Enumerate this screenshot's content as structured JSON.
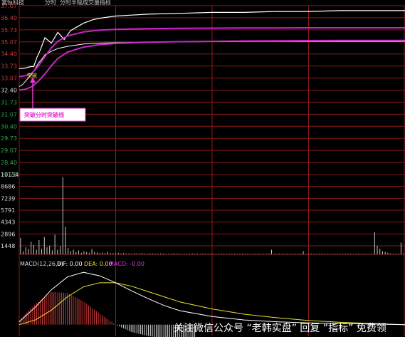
{
  "header": {
    "items": [
      "富恒科技",
      "分时",
      "分时半幅",
      "成交量",
      "指标"
    ]
  },
  "callout": {
    "label": "突破分时突破线",
    "marker": "突破"
  },
  "watermark": {
    "text": "关注微信公众号 “老韩实盘” 回复 “指标” 免费领"
  },
  "colors": {
    "background": "#000000",
    "grid": "#8b1a1a",
    "price_line": "#ffffff",
    "avg_line": "#ffffff",
    "channel_upper": "#c727c7",
    "channel_lower": "#c727c7",
    "volume": "#c8c8c8",
    "macd_hist_up": "#d23a3a",
    "macd_hist_down": "#e0e0e0",
    "dif_line": "#ffffff",
    "dea_line": "#e8e030",
    "callout": "#e23bd0"
  },
  "chart_data": [
    {
      "type": "line",
      "panel": "price",
      "y_ticks_upper": [
        "37.07",
        "36.40",
        "35.73",
        "35.07",
        "34.40",
        "33.73",
        "33.07"
      ],
      "y_tick_mid": "32.40",
      "y_ticks_lower": [
        "31.73",
        "31.07",
        "30.40",
        "29.73",
        "29.07",
        "28.40",
        "27.73"
      ],
      "ylim": [
        27.73,
        37.07
      ],
      "series": [
        {
          "role": "price",
          "x": [
            0,
            2,
            5,
            7,
            9,
            11,
            13,
            16,
            20,
            24,
            28,
            32,
            36,
            40,
            46,
            52,
            60,
            70,
            80,
            100,
            120,
            140,
            160,
            180,
            200,
            220,
            240
          ],
          "values": [
            33.6,
            33.6,
            33.65,
            33.7,
            33.7,
            34.2,
            34.6,
            35.3,
            35.0,
            35.6,
            35.2,
            35.7,
            35.9,
            36.1,
            36.3,
            36.4,
            36.5,
            36.55,
            36.6,
            36.65,
            36.7,
            36.7,
            36.75,
            36.75,
            36.8,
            36.8,
            36.8
          ]
        },
        {
          "role": "average",
          "x": [
            0,
            2,
            4,
            6,
            8,
            10,
            12,
            14,
            16,
            20,
            24,
            30,
            40,
            50,
            60,
            80,
            100,
            120,
            140,
            160,
            180,
            200,
            220,
            240
          ],
          "values": [
            32.6,
            32.7,
            32.9,
            33.1,
            33.3,
            33.6,
            33.9,
            34.1,
            34.35,
            34.55,
            34.7,
            34.82,
            34.95,
            35.0,
            35.02,
            35.05,
            35.07,
            35.08,
            35.09,
            35.1,
            35.1,
            35.1,
            35.1,
            35.1
          ]
        },
        {
          "role": "channel_upper",
          "x": [
            0,
            4,
            8,
            12,
            16,
            20,
            24,
            30,
            40,
            50,
            60,
            80,
            100,
            120,
            140,
            160,
            180,
            200,
            220,
            240
          ],
          "values": [
            33.15,
            33.2,
            33.35,
            33.75,
            34.25,
            34.75,
            35.1,
            35.4,
            35.62,
            35.72,
            35.76,
            35.8,
            35.82,
            35.83,
            35.84,
            35.84,
            35.85,
            35.85,
            35.85,
            35.85
          ]
        },
        {
          "role": "channel_lower",
          "x": [
            0,
            4,
            8,
            12,
            16,
            20,
            24,
            30,
            40,
            50,
            60,
            80,
            100,
            120,
            140,
            160,
            180,
            200,
            220,
            240
          ],
          "values": [
            32.4,
            32.45,
            32.6,
            32.9,
            33.3,
            33.75,
            34.15,
            34.5,
            34.78,
            34.92,
            34.98,
            35.05,
            35.08,
            35.1,
            35.12,
            35.13,
            35.14,
            35.15,
            35.15,
            35.15
          ]
        }
      ]
    },
    {
      "type": "bar",
      "panel": "volume",
      "y_ticks": [
        "10134",
        "8686",
        "7239",
        "5791",
        "4343",
        "2896",
        "1448"
      ],
      "ylim": [
        0,
        10134
      ],
      "values": [
        2100,
        400,
        900,
        700,
        1600,
        1200,
        600,
        1800,
        700,
        2200,
        900,
        1100,
        500,
        2500,
        600,
        1000,
        9800,
        3500,
        800,
        400,
        600,
        300,
        500,
        200,
        400,
        300,
        200,
        700,
        300,
        250,
        180,
        200,
        150,
        300,
        160,
        140,
        120,
        200,
        110,
        150,
        100,
        120,
        90,
        130,
        100,
        110,
        160,
        80,
        90,
        120,
        100,
        80,
        90,
        110,
        100,
        70,
        90,
        80,
        120,
        90,
        100,
        80,
        70,
        90,
        100,
        110,
        80,
        90,
        70,
        100,
        90,
        80,
        110,
        90,
        70,
        80,
        90,
        100,
        70,
        80,
        90,
        80,
        70,
        90,
        100,
        80,
        90,
        70,
        80,
        90,
        100,
        80,
        70,
        80,
        90,
        600,
        80,
        70,
        90,
        100,
        80,
        90,
        70,
        80,
        90,
        100,
        80,
        400,
        70,
        80,
        90,
        80,
        70,
        90,
        100,
        80,
        90,
        70,
        80,
        90,
        100,
        80,
        70,
        80,
        90,
        80,
        70,
        90,
        100,
        80,
        90,
        70,
        80,
        90,
        2800,
        1100,
        700,
        400,
        300,
        200,
        100,
        90,
        80,
        90,
        1500,
        100
      ]
    },
    {
      "type": "line",
      "panel": "macd",
      "title": "MACD(12,26,9)",
      "dif_label": "DIF: 0.00",
      "dea_label": "DEA: 0.00",
      "macd_label": "MACD: -0.00",
      "ylim": [
        -0.2,
        1.0
      ],
      "dif": {
        "x": [
          0,
          10,
          20,
          30,
          40,
          50,
          60,
          70,
          80,
          90,
          100,
          120,
          140,
          160,
          180,
          200,
          220,
          240
        ],
        "values": [
          0.05,
          0.3,
          0.6,
          0.82,
          0.9,
          0.84,
          0.72,
          0.58,
          0.45,
          0.33,
          0.24,
          0.14,
          0.08,
          0.05,
          0.03,
          0.02,
          0.01,
          0.0
        ]
      },
      "dea": {
        "x": [
          0,
          10,
          20,
          30,
          40,
          50,
          60,
          70,
          80,
          90,
          100,
          120,
          140,
          160,
          180,
          200,
          220,
          240
        ],
        "values": [
          0.0,
          0.08,
          0.25,
          0.48,
          0.65,
          0.72,
          0.72,
          0.66,
          0.57,
          0.48,
          0.39,
          0.27,
          0.18,
          0.12,
          0.07,
          0.04,
          0.02,
          0.0
        ]
      },
      "hist_up_count": 38,
      "hist_down_count": 100
    }
  ]
}
